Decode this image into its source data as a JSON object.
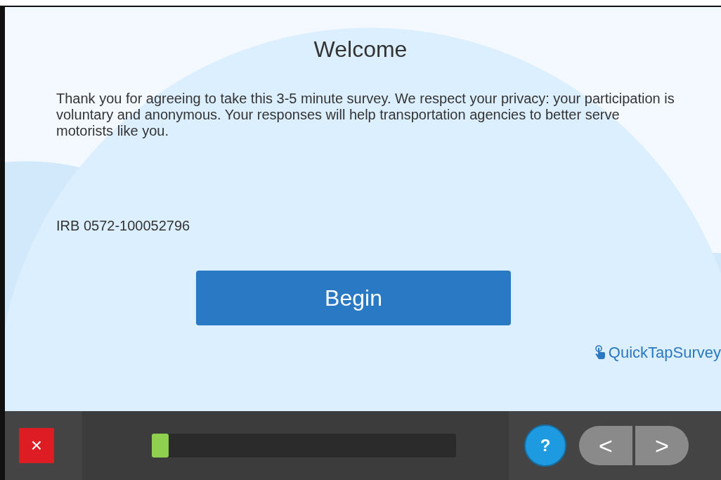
{
  "title": "Welcome",
  "intro": "Thank you for agreeing to take this 3-5 minute survey.  We respect your privacy: your participation is voluntary and anonymous.  Your responses will help transportation agencies to better serve motorists like you.",
  "irb": "IRB 0572-100052796",
  "begin_button": "Begin",
  "brand": "QuickTapSurvey",
  "toolbar": {
    "close": "×",
    "help": "?",
    "progress": {
      "level": 0.055
    },
    "prev": "<",
    "next": ">"
  }
}
